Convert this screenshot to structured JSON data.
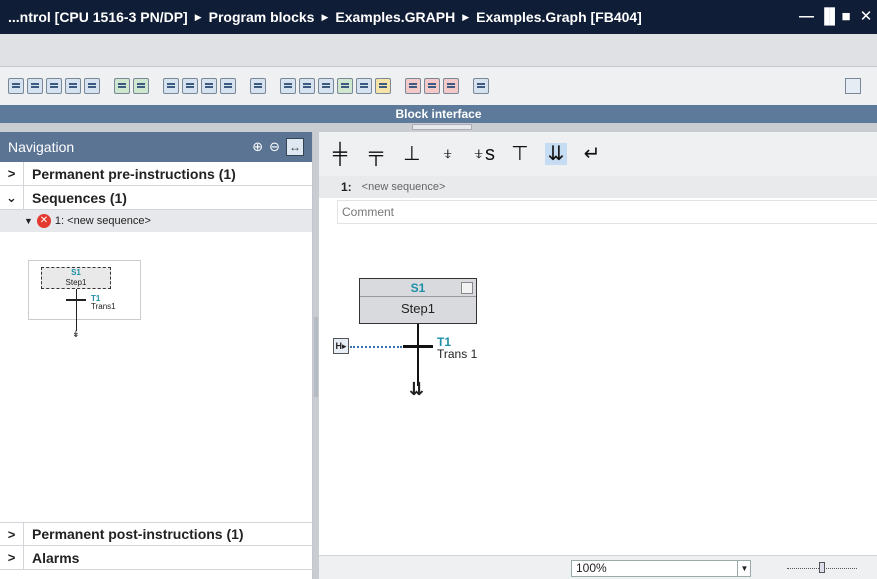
{
  "titlebar": {
    "crumbs": [
      "...ntrol [CPU 1516-3 PN/DP]",
      "Program blocks",
      "Examples.GRAPH",
      "Examples.Graph [FB404]"
    ],
    "separator": "▶",
    "buttons": {
      "minimize": "—",
      "restore": "▐▌",
      "maximize": "■",
      "close": "✕"
    }
  },
  "block_interface": {
    "label": "Block interface"
  },
  "navigation": {
    "title": "Navigation",
    "zoom_in_icon": "⊕",
    "zoom_out_icon": "⊖",
    "fit_icon": "↔",
    "rows": {
      "pre": {
        "chevron": ">",
        "label": "Permanent pre-instructions (1)"
      },
      "sequences": {
        "chevron": "⌄",
        "label": "Sequences (1)"
      },
      "post": {
        "chevron": ">",
        "label": "Permanent post-instructions (1)"
      },
      "alarms": {
        "chevron": ">",
        "label": "Alarms"
      }
    },
    "sequence_item": {
      "expand": "▼",
      "error": "✕",
      "label": "1: <new sequence>"
    },
    "thumbnail": {
      "step_id": "S1",
      "step_name": "Step1",
      "trans_id": "T1",
      "trans_name": "Trans1",
      "arrow": "↡"
    }
  },
  "instruction_bar": {
    "items": [
      "╪",
      "╤",
      "⊥",
      "⍖",
      "⍖s",
      "⊤",
      "⇊",
      "↵"
    ]
  },
  "network": {
    "number": "1:",
    "title": "<new sequence>",
    "comment": "Comment"
  },
  "graph": {
    "step_id": "S1",
    "step_name": "Step1",
    "trans_id": "T1",
    "trans_name": "Trans 1",
    "cond_icon": "H▸",
    "arrow": "⇊"
  },
  "zoom": {
    "value": "100%",
    "dropdown": "▼"
  }
}
